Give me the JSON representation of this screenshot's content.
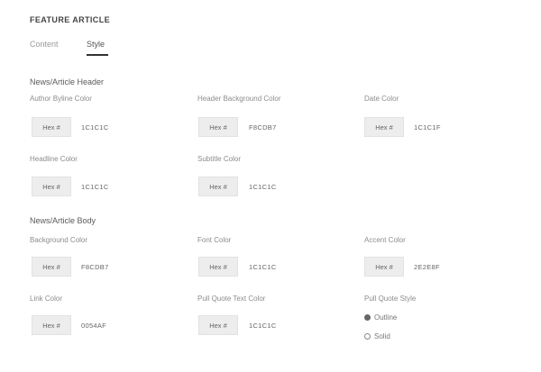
{
  "panel": {
    "title": "FEATURE ARTICLE"
  },
  "tabs": [
    {
      "label": "Content",
      "active": false
    },
    {
      "label": "Style",
      "active": true
    }
  ],
  "sections": [
    {
      "title": "News/Article Header",
      "fields": [
        {
          "label": "Author Byline Color",
          "button": "Hex #",
          "value": "1C1C1C"
        },
        {
          "label": "Header Background Color",
          "button": "Hex #",
          "value": "F8CDB7"
        },
        {
          "label": "Date Color",
          "button": "Hex #",
          "value": "1C1C1F"
        },
        {
          "label": "Headline Color",
          "button": "Hex #",
          "value": "1C1C1C"
        },
        {
          "label": "Subtitle Color",
          "button": "Hex #",
          "value": "1C1C1C"
        }
      ]
    },
    {
      "title": "News/Article Body",
      "fields": [
        {
          "label": "Background Color",
          "button": "Hex #",
          "value": "F8CDB7"
        },
        {
          "label": "Font Color",
          "button": "Hex #",
          "value": "1C1C1C"
        },
        {
          "label": "Accent Color",
          "button": "Hex #",
          "value": "2E2E8F"
        },
        {
          "label": "Link Color",
          "button": "Hex #",
          "value": "0054AF"
        },
        {
          "label": "Pull Quote Text Color",
          "button": "Hex #",
          "value": "1C1C1C"
        }
      ],
      "radio_group": {
        "label": "Pull Quote Style",
        "options": [
          {
            "label": "Outline",
            "checked": true
          },
          {
            "label": "Solid",
            "checked": false
          }
        ]
      }
    }
  ]
}
